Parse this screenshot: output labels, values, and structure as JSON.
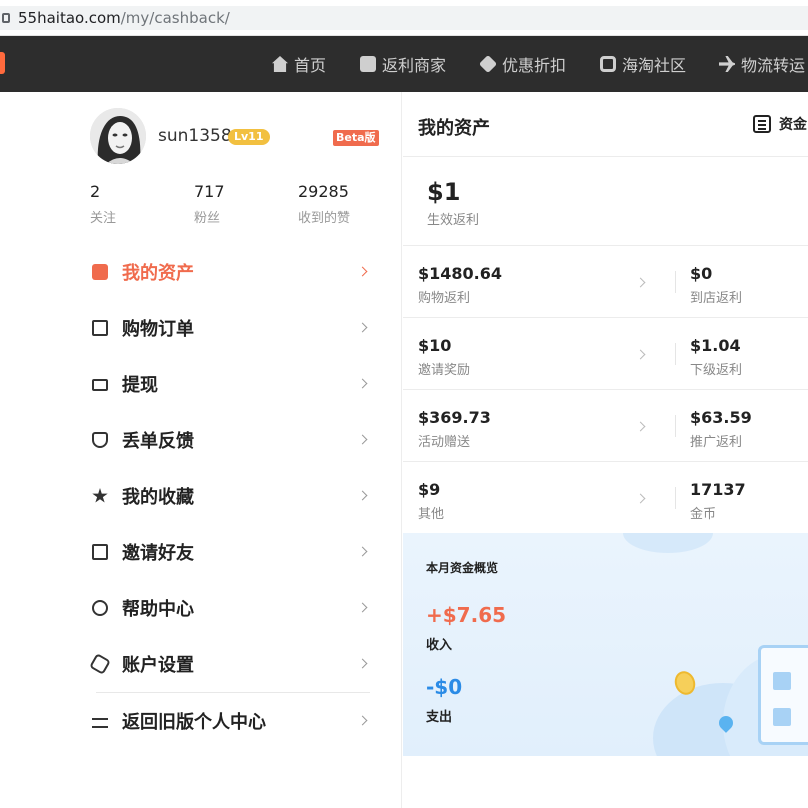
{
  "browser": {
    "url_domain": "55haitao.com",
    "url_path": "/my/cashback/"
  },
  "nav": {
    "items": [
      {
        "label": "首页",
        "icon": "home-icon"
      },
      {
        "label": "返利商家",
        "icon": "store-icon"
      },
      {
        "label": "优惠折扣",
        "icon": "tag-icon"
      },
      {
        "label": "海淘社区",
        "icon": "camera-icon"
      },
      {
        "label": "物流转运",
        "icon": "plane-icon"
      }
    ]
  },
  "profile": {
    "username": "sun1358",
    "level": "Lv11",
    "beta": "Beta版",
    "stats": [
      {
        "value": "2",
        "label": "关注"
      },
      {
        "value": "717",
        "label": "粉丝"
      },
      {
        "value": "29285",
        "label": "收到的赞"
      }
    ]
  },
  "menu": {
    "items": [
      {
        "label": "我的资产",
        "icon": "wallet-icon",
        "active": true
      },
      {
        "label": "购物订单",
        "icon": "order-icon"
      },
      {
        "label": "提现",
        "icon": "card-icon"
      },
      {
        "label": "丢单反馈",
        "icon": "shield-icon"
      },
      {
        "label": "我的收藏",
        "icon": "star-icon"
      },
      {
        "label": "邀请好友",
        "icon": "gift-icon"
      },
      {
        "label": "帮助中心",
        "icon": "help-icon"
      },
      {
        "label": "账户设置",
        "icon": "gear-icon"
      }
    ],
    "legacy": {
      "label": "返回旧版个人中心",
      "icon": "swap-icon"
    }
  },
  "assets": {
    "title": "我的资产",
    "fund_link": "资金",
    "effective": {
      "amount": "$1",
      "label": "生效返利"
    },
    "rows": [
      {
        "left": {
          "amount": "$1480.64",
          "label": "购物返利"
        },
        "right": {
          "amount": "$0",
          "label": "到店返利"
        }
      },
      {
        "left": {
          "amount": "$10",
          "label": "邀请奖励"
        },
        "right": {
          "amount": "$1.04",
          "label": "下级返利"
        }
      },
      {
        "left": {
          "amount": "$369.73",
          "label": "活动赠送"
        },
        "right": {
          "amount": "$63.59",
          "label": "推广返利"
        }
      },
      {
        "left": {
          "amount": "$9",
          "label": "其他"
        },
        "right": {
          "amount": "17137",
          "label": "金币"
        }
      }
    ]
  },
  "summary": {
    "title": "本月资金概览",
    "income": "+$7.65",
    "income_label": "收入",
    "expense": "-$0",
    "expense_label": "支出"
  },
  "colors": {
    "accent": "#f06b4d",
    "nav_bg": "#2d2d2d",
    "expense_blue": "#2b8be6",
    "level_badge": "#f2c040"
  }
}
